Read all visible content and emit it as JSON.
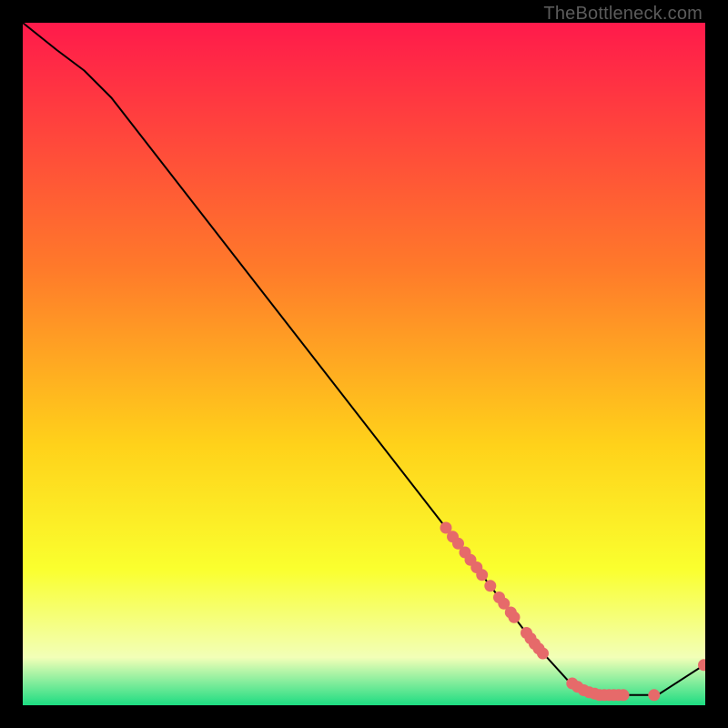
{
  "watermark": "TheBottleneck.com",
  "colors": {
    "background_black": "#000000",
    "gradient_top": "#ff1a4b",
    "gradient_mid1": "#ff7a2a",
    "gradient_mid2": "#ffd21a",
    "gradient_mid3": "#faff2e",
    "gradient_low": "#f2ffb7",
    "gradient_bottom": "#1ddc82",
    "curve_color": "#000000",
    "dot_color": "#e66a6a"
  },
  "chart_data": {
    "type": "line",
    "title": "",
    "xlabel": "",
    "ylabel": "",
    "xlim": [
      0,
      100
    ],
    "ylim": [
      0,
      100
    ],
    "curve": [
      {
        "x": 0,
        "y": 100
      },
      {
        "x": 5,
        "y": 96
      },
      {
        "x": 9,
        "y": 93
      },
      {
        "x": 13,
        "y": 89
      },
      {
        "x": 62,
        "y": 26
      },
      {
        "x": 75,
        "y": 9
      },
      {
        "x": 80,
        "y": 3.5
      },
      {
        "x": 84,
        "y": 1.5
      },
      {
        "x": 93,
        "y": 1.5
      },
      {
        "x": 100,
        "y": 6
      }
    ],
    "dots": [
      {
        "x": 62.0,
        "y": 26.0
      },
      {
        "x": 63.0,
        "y": 24.7
      },
      {
        "x": 63.8,
        "y": 23.7
      },
      {
        "x": 64.8,
        "y": 22.4
      },
      {
        "x": 65.6,
        "y": 21.3
      },
      {
        "x": 66.5,
        "y": 20.2
      },
      {
        "x": 67.3,
        "y": 19.1
      },
      {
        "x": 68.5,
        "y": 17.5
      },
      {
        "x": 69.8,
        "y": 15.8
      },
      {
        "x": 70.5,
        "y": 14.9
      },
      {
        "x": 71.5,
        "y": 13.6
      },
      {
        "x": 72.0,
        "y": 12.9
      },
      {
        "x": 73.8,
        "y": 10.6
      },
      {
        "x": 74.4,
        "y": 9.8
      },
      {
        "x": 75.0,
        "y": 9.0
      },
      {
        "x": 75.6,
        "y": 8.3
      },
      {
        "x": 76.2,
        "y": 7.6
      },
      {
        "x": 80.5,
        "y": 3.2
      },
      {
        "x": 81.3,
        "y": 2.7
      },
      {
        "x": 82.2,
        "y": 2.2
      },
      {
        "x": 83.0,
        "y": 1.9
      },
      {
        "x": 83.8,
        "y": 1.7
      },
      {
        "x": 84.5,
        "y": 1.5
      },
      {
        "x": 85.2,
        "y": 1.5
      },
      {
        "x": 85.9,
        "y": 1.5
      },
      {
        "x": 86.6,
        "y": 1.5
      },
      {
        "x": 87.3,
        "y": 1.5
      },
      {
        "x": 88.0,
        "y": 1.5
      },
      {
        "x": 92.5,
        "y": 1.5
      },
      {
        "x": 99.8,
        "y": 5.9
      }
    ]
  }
}
